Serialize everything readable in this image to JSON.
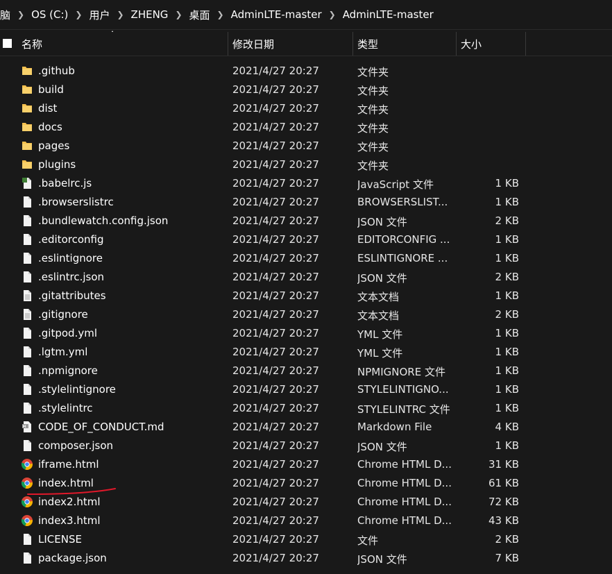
{
  "breadcrumb": [
    "脑",
    "OS (C:)",
    "用户",
    "ZHENG",
    "桌面",
    "AdminLTE-master",
    "AdminLTE-master"
  ],
  "header": {
    "name": "名称",
    "modified": "修改日期",
    "type": "类型",
    "size": "大小"
  },
  "files": [
    {
      "name": ".github",
      "date": "2021/4/27 20:27",
      "type": "文件夹",
      "size": "",
      "icon": "folder-icon"
    },
    {
      "name": "build",
      "date": "2021/4/27 20:27",
      "type": "文件夹",
      "size": "",
      "icon": "folder-icon"
    },
    {
      "name": "dist",
      "date": "2021/4/27 20:27",
      "type": "文件夹",
      "size": "",
      "icon": "folder-icon"
    },
    {
      "name": "docs",
      "date": "2021/4/27 20:27",
      "type": "文件夹",
      "size": "",
      "icon": "folder-icon"
    },
    {
      "name": "pages",
      "date": "2021/4/27 20:27",
      "type": "文件夹",
      "size": "",
      "icon": "folder-icon"
    },
    {
      "name": "plugins",
      "date": "2021/4/27 20:27",
      "type": "文件夹",
      "size": "",
      "icon": "folder-icon"
    },
    {
      "name": ".babelrc.js",
      "date": "2021/4/27 20:27",
      "type": "JavaScript 文件",
      "size": "1 KB",
      "icon": "js-file-icon"
    },
    {
      "name": ".browserslistrc",
      "date": "2021/4/27 20:27",
      "type": "BROWSERSLIST...",
      "size": "1 KB",
      "icon": "file-icon"
    },
    {
      "name": ".bundlewatch.config.json",
      "date": "2021/4/27 20:27",
      "type": "JSON 文件",
      "size": "2 KB",
      "icon": "file-icon"
    },
    {
      "name": ".editorconfig",
      "date": "2021/4/27 20:27",
      "type": "EDITORCONFIG ...",
      "size": "1 KB",
      "icon": "file-icon"
    },
    {
      "name": ".eslintignore",
      "date": "2021/4/27 20:27",
      "type": "ESLINTIGNORE ...",
      "size": "1 KB",
      "icon": "file-icon"
    },
    {
      "name": ".eslintrc.json",
      "date": "2021/4/27 20:27",
      "type": "JSON 文件",
      "size": "2 KB",
      "icon": "file-icon"
    },
    {
      "name": ".gitattributes",
      "date": "2021/4/27 20:27",
      "type": "文本文档",
      "size": "1 KB",
      "icon": "text-file-icon"
    },
    {
      "name": ".gitignore",
      "date": "2021/4/27 20:27",
      "type": "文本文档",
      "size": "2 KB",
      "icon": "text-file-icon"
    },
    {
      "name": ".gitpod.yml",
      "date": "2021/4/27 20:27",
      "type": "YML 文件",
      "size": "1 KB",
      "icon": "file-icon"
    },
    {
      "name": ".lgtm.yml",
      "date": "2021/4/27 20:27",
      "type": "YML 文件",
      "size": "1 KB",
      "icon": "file-icon"
    },
    {
      "name": ".npmignore",
      "date": "2021/4/27 20:27",
      "type": "NPMIGNORE 文件",
      "size": "1 KB",
      "icon": "file-icon"
    },
    {
      "name": ".stylelintignore",
      "date": "2021/4/27 20:27",
      "type": "STYLELINTIGNO...",
      "size": "1 KB",
      "icon": "file-icon"
    },
    {
      "name": ".stylelintrc",
      "date": "2021/4/27 20:27",
      "type": "STYLELINTRC 文件",
      "size": "1 KB",
      "icon": "file-icon"
    },
    {
      "name": "CODE_OF_CONDUCT.md",
      "date": "2021/4/27 20:27",
      "type": "Markdown File",
      "size": "4 KB",
      "icon": "markdown-file-icon"
    },
    {
      "name": "composer.json",
      "date": "2021/4/27 20:27",
      "type": "JSON 文件",
      "size": "1 KB",
      "icon": "file-icon"
    },
    {
      "name": "iframe.html",
      "date": "2021/4/27 20:27",
      "type": "Chrome HTML D...",
      "size": "31 KB",
      "icon": "chrome-icon"
    },
    {
      "name": "index.html",
      "date": "2021/4/27 20:27",
      "type": "Chrome HTML D...",
      "size": "61 KB",
      "icon": "chrome-icon"
    },
    {
      "name": "index2.html",
      "date": "2021/4/27 20:27",
      "type": "Chrome HTML D...",
      "size": "72 KB",
      "icon": "chrome-icon"
    },
    {
      "name": "index3.html",
      "date": "2021/4/27 20:27",
      "type": "Chrome HTML D...",
      "size": "43 KB",
      "icon": "chrome-icon"
    },
    {
      "name": "LICENSE",
      "date": "2021/4/27 20:27",
      "type": "文件",
      "size": "2 KB",
      "icon": "file-icon"
    },
    {
      "name": "package.json",
      "date": "2021/4/27 20:27",
      "type": "JSON 文件",
      "size": "7 KB",
      "icon": "file-icon"
    }
  ],
  "colors": {
    "background": "#191919",
    "folder": "#f5c04e",
    "annotation": "#e0182a"
  }
}
